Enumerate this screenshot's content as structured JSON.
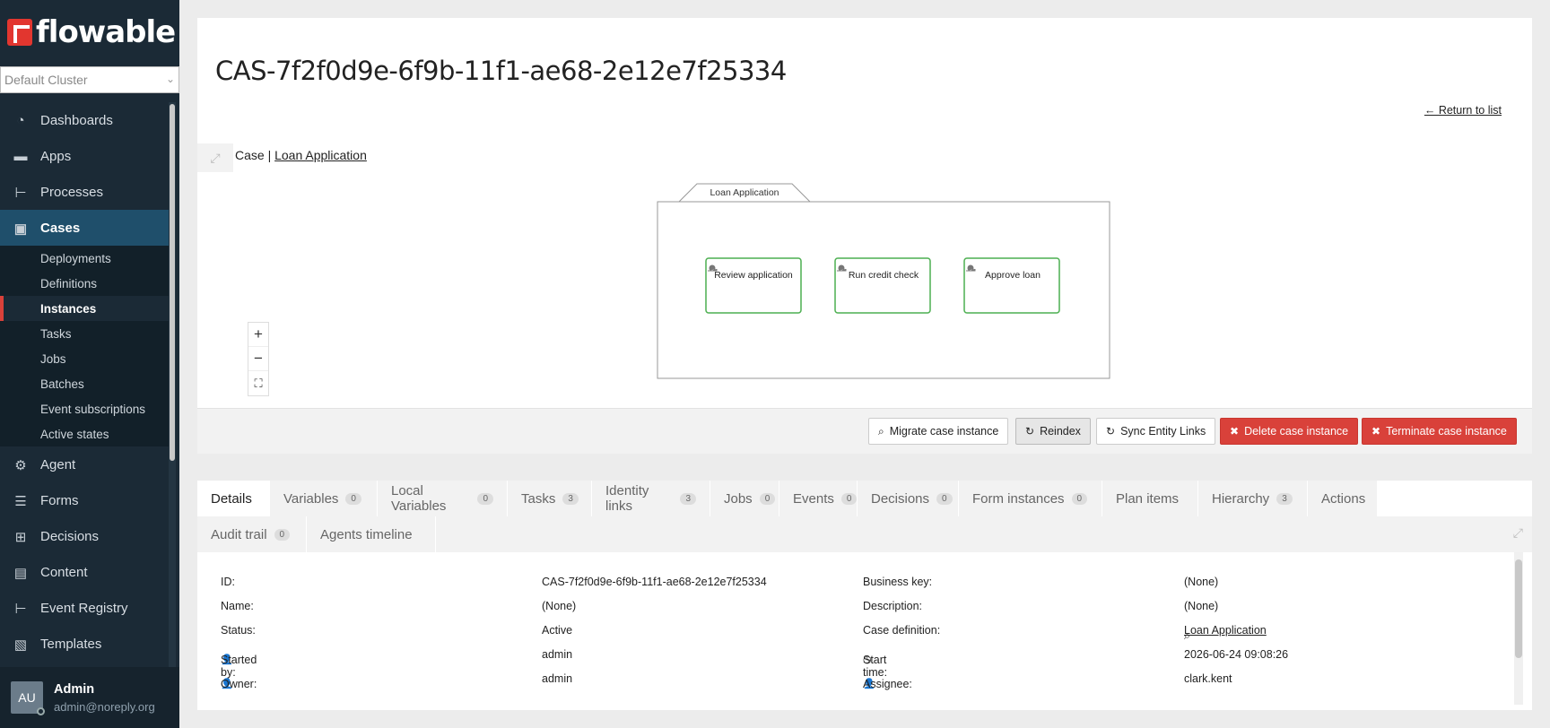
{
  "brand": {
    "name": "flowable"
  },
  "cluster": {
    "value": "Default Cluster"
  },
  "nav": [
    {
      "label": "Dashboards",
      "icon": "pie-chart-icon"
    },
    {
      "label": "Apps",
      "icon": "apps-icon"
    },
    {
      "label": "Processes",
      "icon": "process-icon"
    },
    {
      "label": "Cases",
      "icon": "briefcase-icon",
      "active": true
    },
    {
      "label": "Agent",
      "icon": "gear-icon"
    },
    {
      "label": "Forms",
      "icon": "form-icon"
    },
    {
      "label": "Decisions",
      "icon": "table-icon"
    },
    {
      "label": "Content",
      "icon": "document-icon"
    },
    {
      "label": "Event Registry",
      "icon": "event-icon"
    },
    {
      "label": "Templates",
      "icon": "template-icon"
    }
  ],
  "subnav": [
    "Deployments",
    "Definitions",
    "Instances",
    "Tasks",
    "Jobs",
    "Batches",
    "Event subscriptions",
    "Active states"
  ],
  "user": {
    "initials": "AU",
    "name": "Admin",
    "email": "admin@noreply.org"
  },
  "case": {
    "title": "CAS-7f2f0d9e-6f9b-11f1-ae68-2e12e7f25334",
    "return_link": "← Return to list",
    "crumb_prefix": "Case |",
    "crumb_link": "Loan Application"
  },
  "diagram": {
    "stage_label": "Loan Application",
    "tasks": [
      "Review application",
      "Run credit check",
      "Approve loan"
    ]
  },
  "actions": {
    "migrate": "Migrate case instance",
    "reindex": "Reindex",
    "sync": "Sync Entity Links",
    "delete": "Delete case instance",
    "terminate": "Terminate case instance"
  },
  "tabs": [
    {
      "label": "Details"
    },
    {
      "label": "Variables",
      "badge": "0"
    },
    {
      "label": "Local Variables",
      "badge": "0"
    },
    {
      "label": "Tasks",
      "badge": "3"
    },
    {
      "label": "Identity links",
      "badge": "3"
    },
    {
      "label": "Jobs",
      "badge": "0"
    },
    {
      "label": "Events",
      "badge": "0"
    },
    {
      "label": "Decisions",
      "badge": "0"
    },
    {
      "label": "Form instances",
      "badge": "0"
    },
    {
      "label": "Plan items"
    },
    {
      "label": "Hierarchy",
      "badge": "3"
    },
    {
      "label": "Actions"
    },
    {
      "label": "Audit trail",
      "badge": "0"
    },
    {
      "label": "Agents timeline"
    }
  ],
  "details": {
    "id_label": "ID:",
    "id_value": "CAS-7f2f0d9e-6f9b-11f1-ae68-2e12e7f25334",
    "business_key_label": "Business key:",
    "business_key_value": "(None)",
    "name_label": "Name:",
    "name_value": "(None)",
    "description_label": "Description:",
    "description_value": "(None)",
    "status_label": "Status:",
    "status_value": "Active",
    "case_def_label": "Case definition:",
    "case_def_value": "Loan Application",
    "started_by_label": "Started by:",
    "started_by_value": "admin",
    "start_time_label": "Start time:",
    "start_time_value": "2026-06-24 09:08:26",
    "owner_label": "Owner:",
    "owner_value": "admin",
    "assignee_label": "Assignee:",
    "assignee_value": "clark.kent"
  },
  "colors": {
    "sidebar": "#1b2a36",
    "active_nav": "#1f4f6b",
    "danger": "#d9413a",
    "task_border": "#4caf50"
  }
}
